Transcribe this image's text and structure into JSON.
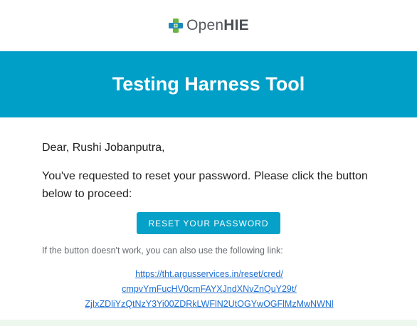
{
  "brand": {
    "logo_light": "Open",
    "logo_bold": "HIE",
    "icon": "openhie-cross-icon"
  },
  "banner": {
    "title": "Testing Harness Tool"
  },
  "email": {
    "greeting": "Dear, Rushi Jobanputra,",
    "message": "You've requested to reset your password. Please click the button below to proceed:",
    "button_label": "RESET YOUR PASSWORD",
    "fallback_text": "If the button doesn't work, you can also use the following link:",
    "link_lines": [
      "https://tht.argusservices.in/reset/cred/",
      "cmpvYmFucHV0cmFAYXJndXNvZnQuY29t/",
      "ZjIxZDliYzQtNzY3Yi00ZDRkLWFlN2UtOGYwOGFlMzMwNWNl"
    ]
  },
  "colors": {
    "banner_bg": "#009fc7",
    "button_bg": "#06a1c9",
    "link": "#1f6fd1",
    "footer_bg": "#eef7ee",
    "logo_green": "#6bb33f",
    "logo_blue": "#1e88b8"
  }
}
